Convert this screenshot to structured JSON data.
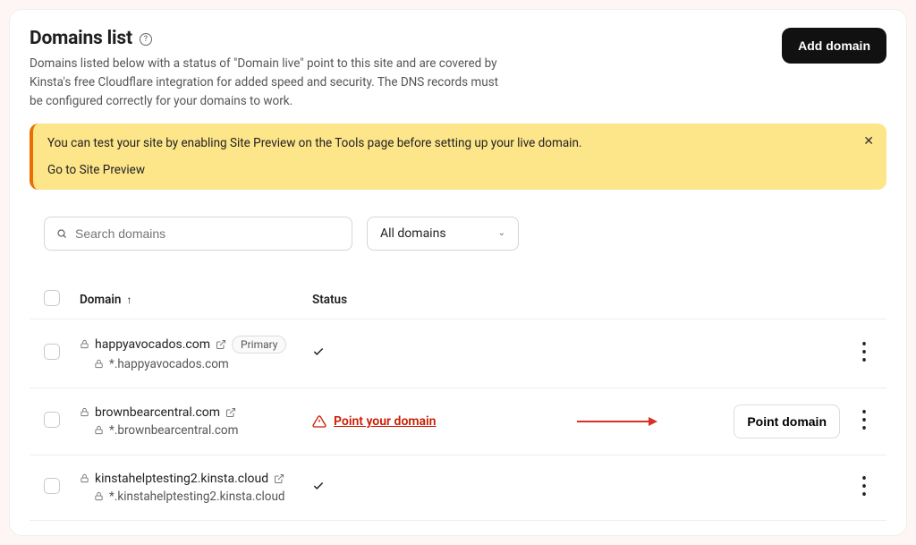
{
  "header": {
    "title": "Domains list",
    "subtitle": "Domains listed below with a status of \"Domain live\" point to this site and are covered by Kinsta's free Cloudflare integration for added speed and security. The DNS records must be configured correctly for your domains to work.",
    "add_button": "Add domain"
  },
  "banner": {
    "text": "You can test your site by enabling Site Preview on the Tools page before setting up your live domain.",
    "link": "Go to Site Preview"
  },
  "controls": {
    "search_placeholder": "Search domains",
    "filter_selected": "All domains"
  },
  "table": {
    "headers": {
      "domain": "Domain",
      "status": "Status"
    },
    "primary_badge": "Primary",
    "point_link": "Point your domain",
    "point_button": "Point domain",
    "rows": [
      {
        "domain": "happyavocados.com",
        "wildcard": "*.happyavocados.com",
        "primary": true,
        "status": "ok"
      },
      {
        "domain": "brownbearcentral.com",
        "wildcard": "*.brownbearcentral.com",
        "primary": false,
        "status": "point"
      },
      {
        "domain": "kinstahelptesting2.kinsta.cloud",
        "wildcard": "*.kinstahelptesting2.kinsta.cloud",
        "primary": false,
        "status": "ok"
      }
    ]
  }
}
